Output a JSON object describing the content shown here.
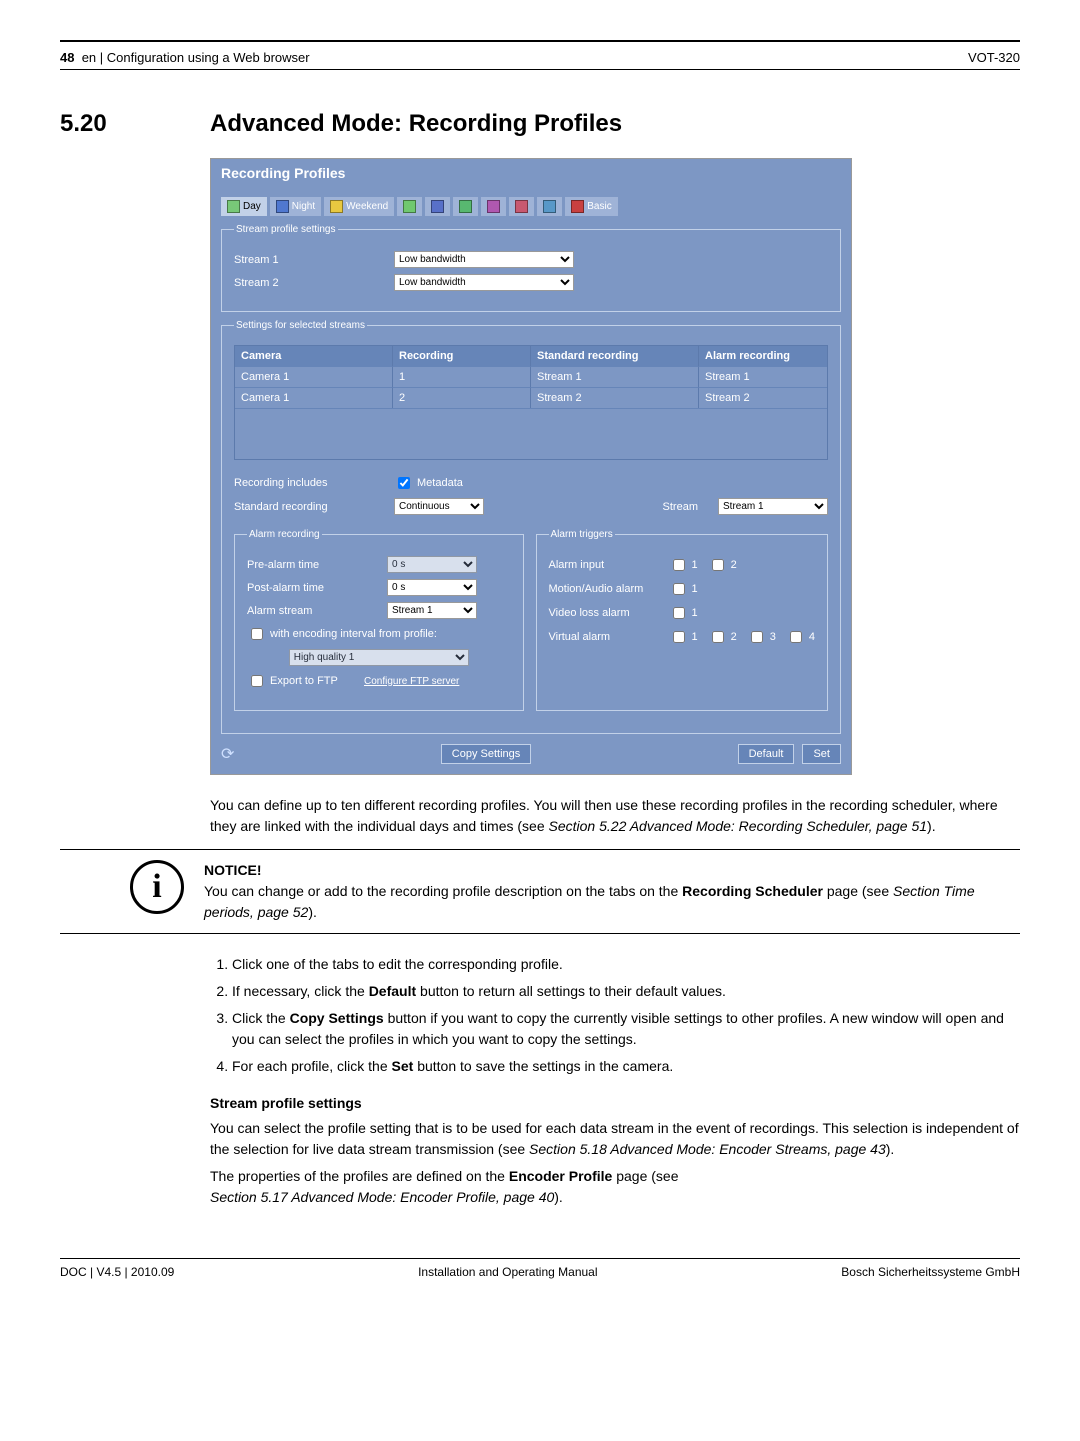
{
  "header": {
    "page_num": "48",
    "lang": "en",
    "breadcrumb": "Configuration using a Web browser",
    "model": "VOT-320"
  },
  "section": {
    "number": "5.20",
    "title": "Advanced Mode: Recording Profiles"
  },
  "panel": {
    "title": "Recording Profiles",
    "tabs": [
      {
        "label": "Day",
        "color": "#78c878"
      },
      {
        "label": "Night",
        "color": "#5078d0"
      },
      {
        "label": "Weekend",
        "color": "#e8c840"
      },
      {
        "label": "",
        "color": "#70c870"
      },
      {
        "label": "",
        "color": "#5870c8"
      },
      {
        "label": "",
        "color": "#58b870"
      },
      {
        "label": "",
        "color": "#b058b0"
      },
      {
        "label": "",
        "color": "#c85870"
      },
      {
        "label": "",
        "color": "#5898c8"
      },
      {
        "label": "Basic",
        "color": "#c84040"
      }
    ],
    "stream_profile_legend": "Stream profile settings",
    "stream1_label": "Stream 1",
    "stream1_value": "Low bandwidth",
    "stream2_label": "Stream 2",
    "stream2_value": "Low bandwidth",
    "selected_legend": "Settings for selected streams",
    "table": {
      "headers": [
        "Camera",
        "Recording",
        "Standard recording",
        "Alarm recording"
      ],
      "rows": [
        [
          "Camera 1",
          "1",
          "Stream 1",
          "Stream 1"
        ],
        [
          "Camera 1",
          "2",
          "Stream 2",
          "Stream 2"
        ]
      ]
    },
    "rec_includes_label": "Recording includes",
    "metadata_label": "Metadata",
    "std_rec_label": "Standard recording",
    "std_rec_value": "Continuous",
    "stream_label": "Stream",
    "stream_value": "Stream 1",
    "alarm_rec_legend": "Alarm recording",
    "pre_alarm_label": "Pre-alarm time",
    "pre_alarm_value": "0 s",
    "post_alarm_label": "Post-alarm time",
    "post_alarm_value": "0 s",
    "alarm_stream_label": "Alarm stream",
    "alarm_stream_value": "Stream 1",
    "encoding_chk_label": "with encoding interval from profile:",
    "encoding_profile_value": "High quality 1",
    "export_ftp_label": "Export to FTP",
    "config_ftp_link": "Configure FTP server",
    "triggers_legend": "Alarm triggers",
    "alarm_input_label": "Alarm input",
    "alarm_input_opts": [
      "1",
      "2"
    ],
    "motion_label": "Motion/Audio alarm",
    "motion_opts": [
      "1"
    ],
    "video_loss_label": "Video loss alarm",
    "video_loss_opts": [
      "1"
    ],
    "virtual_label": "Virtual alarm",
    "virtual_opts": [
      "1",
      "2",
      "3",
      "4"
    ],
    "copy_btn": "Copy Settings",
    "default_btn": "Default",
    "set_btn": "Set"
  },
  "body": {
    "intro": "You can define up to ten different recording profiles. You will then use these recording profiles in the recording scheduler, where they are linked with the individual days and times (see ",
    "intro_ref": "Section 5.22 Advanced Mode: Recording Scheduler, page 51",
    "intro_end": ").",
    "notice_title": "NOTICE!",
    "notice_text_1": "You can change or add to the recording profile description on the tabs on the ",
    "notice_bold_1": "Recording Scheduler",
    "notice_text_2": " page (see ",
    "notice_ref": "Section  Time periods, page 52",
    "notice_end": ").",
    "steps": [
      "Click one of the tabs to edit the corresponding profile.",
      "If necessary, click the <b>Default</b> button to return all settings to their default values.",
      "Click the <b>Copy Settings</b> button if you want to copy the currently visible settings to other profiles. A new window will open and you can select the profiles in which you want to copy the settings.",
      "For each profile, click the <b>Set</b> button to save the settings in the camera."
    ],
    "sub_head": "Stream profile settings",
    "para2_a": "You can select the profile setting that is to be used for each data stream in the event of recordings. This selection is independent of the selection for live data stream transmission (see ",
    "para2_ref": "Section 5.18 Advanced Mode: Encoder Streams, page 43",
    "para2_b": ").",
    "para3_a": "The properties of the profiles are defined on the ",
    "para3_bold": "Encoder Profile",
    "para3_b": " page (see ",
    "para3_ref": "Section 5.17 Advanced Mode: Encoder Profile, page 40",
    "para3_c": ")."
  },
  "footer": {
    "left": "DOC | V4.5 | 2010.09",
    "center": "Installation and Operating Manual",
    "right": "Bosch Sicherheitssysteme GmbH"
  }
}
